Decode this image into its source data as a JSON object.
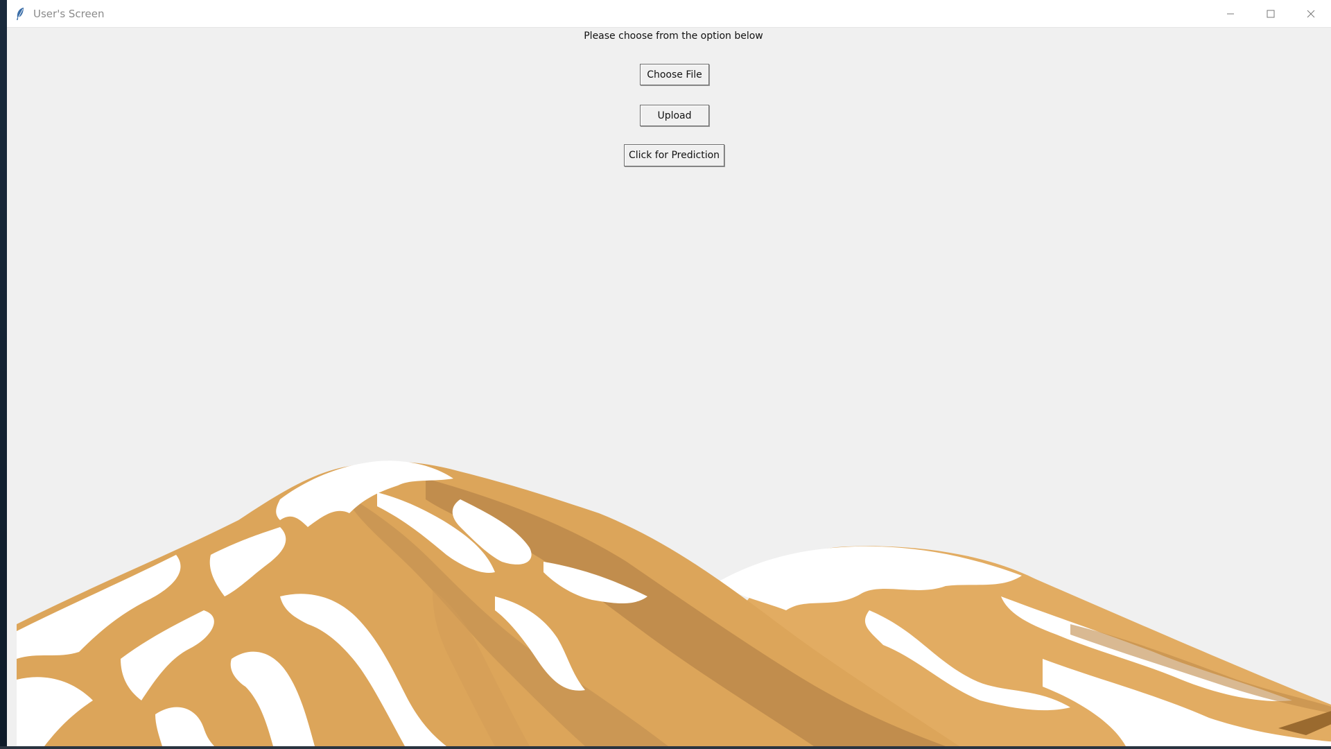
{
  "window": {
    "title": "User's Screen",
    "icon": "feather-icon",
    "controls": [
      "minimize-icon",
      "maximize-icon",
      "close-icon"
    ]
  },
  "main": {
    "prompt": "Please choose from the option below",
    "buttons": {
      "choose_file": "Choose File",
      "upload": "Upload",
      "prediction": "Click for Prediction"
    }
  },
  "background": {
    "image": "mountain-illustration",
    "colors": {
      "window": "#f0f0f0",
      "mountain": "#dca55a",
      "shade": "#b8864a",
      "snow": "#ffffff"
    }
  }
}
